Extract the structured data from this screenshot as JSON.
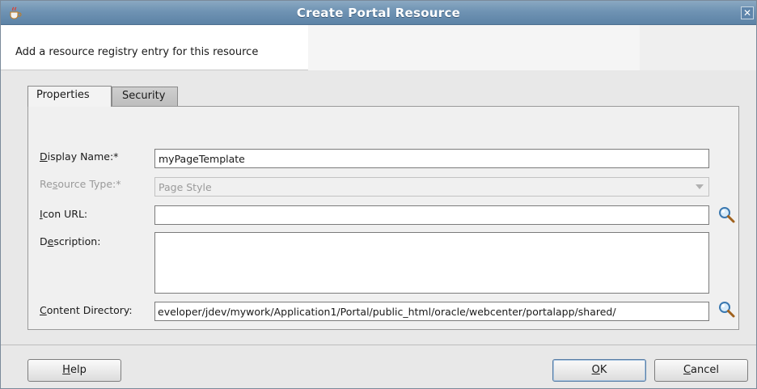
{
  "window": {
    "title": "Create Portal Resource",
    "close_glyph": "✕"
  },
  "header": {
    "description": "Add a resource registry entry for this resource"
  },
  "tabs": [
    {
      "label": "Properties",
      "active": true
    },
    {
      "label": "Security",
      "active": false
    }
  ],
  "form": {
    "display_name": {
      "label_u": "D",
      "label_rest": "isplay Name:*",
      "value": "myPageTemplate"
    },
    "resource_type": {
      "label_pre": "Re",
      "label_u": "s",
      "label_rest": "ource Type:*",
      "value": "Page Style"
    },
    "icon_url": {
      "label_u": "I",
      "label_rest": "con URL:",
      "value": ""
    },
    "description": {
      "label_pre": "D",
      "label_u": "e",
      "label_rest": "scription:",
      "value": ""
    },
    "content_directory": {
      "label_u": "C",
      "label_rest": "ontent Directory:",
      "value": "eveloper/jdev/mywork/Application1/Portal/public_html/oracle/webcenter/portalapp/shared/"
    }
  },
  "buttons": {
    "help": {
      "u": "H",
      "rest": "elp"
    },
    "ok": {
      "u": "O",
      "rest": "K"
    },
    "cancel": {
      "u": "C",
      "rest": "ancel"
    }
  },
  "icons": {
    "app": "java-cup-icon",
    "search": "magnifier-icon"
  },
  "colors": {
    "titlebar": "#6f93b3",
    "panel": "#f0f0f0",
    "default_button_border": "#5a7fa6"
  }
}
